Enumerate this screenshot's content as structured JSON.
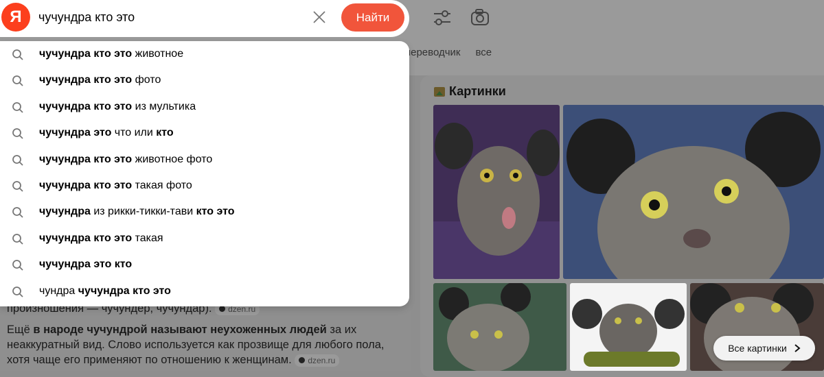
{
  "search": {
    "logo": "Я",
    "query": "чучундра кто это",
    "find_label": "Найти"
  },
  "tabs": [
    "переводчик",
    "все"
  ],
  "suggestions": [
    [
      {
        "t": "чучундра кто это",
        "b": true
      },
      {
        "t": " животное",
        "b": false
      }
    ],
    [
      {
        "t": "чучундра кто это",
        "b": true
      },
      {
        "t": " фото",
        "b": false
      }
    ],
    [
      {
        "t": "чучундра кто это",
        "b": true
      },
      {
        "t": " из мультика",
        "b": false
      }
    ],
    [
      {
        "t": "чучундра это",
        "b": true
      },
      {
        "t": " что или ",
        "b": false
      },
      {
        "t": "кто",
        "b": true
      }
    ],
    [
      {
        "t": "чучундра кто это",
        "b": true
      },
      {
        "t": " животное фото",
        "b": false
      }
    ],
    [
      {
        "t": "чучундра кто это",
        "b": true
      },
      {
        "t": " такая фото",
        "b": false
      }
    ],
    [
      {
        "t": "чучундра",
        "b": true
      },
      {
        "t": " из рикки-тикки-тави ",
        "b": false
      },
      {
        "t": "кто это",
        "b": true
      }
    ],
    [
      {
        "t": "чучундра кто это",
        "b": true
      },
      {
        "t": " такая",
        "b": false
      }
    ],
    [
      {
        "t": "чучундра это кто",
        "b": true
      }
    ],
    [
      {
        "t": "чундра ",
        "b": false
      },
      {
        "t": "чучундра кто это",
        "b": true
      }
    ]
  ],
  "result": {
    "line1": "произношения — чучундер, чучундар).",
    "source1": "dzen.ru",
    "para_pre": "Ещё ",
    "para_bold": "в народе чучундрой называют неухоженных людей",
    "para_post": " за их неаккуратный вид. Слово используется как прозвище для любого пола, хотя чаще его применяют по отношению к женщинам.",
    "source2": "dzen.ru"
  },
  "images": {
    "title": "Картинки",
    "all_label": "Все картинки"
  },
  "colors": {
    "accent": "#f1553b",
    "logo": "#fc3f1d"
  }
}
